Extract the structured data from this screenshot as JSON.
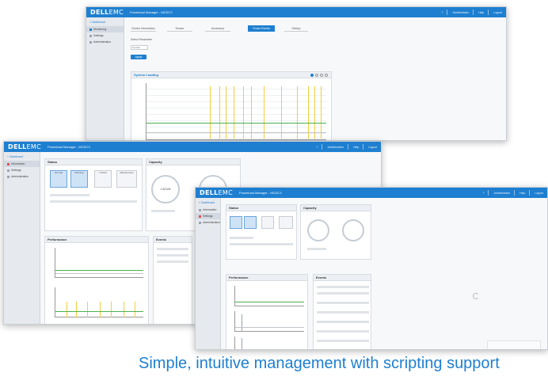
{
  "window_back": {
    "logo_main": "DELL",
    "logo_sub": "EMC",
    "title": "Powerload Manager - MCDC3",
    "titlebar_buttons": [
      "?",
      "Administrator",
      "Help",
      "Logout"
    ],
    "sidebar": {
      "back_link": "< Dashboard",
      "items": [
        {
          "label": "Monitoring"
        },
        {
          "label": "Settings"
        },
        {
          "label": "Administration"
        }
      ]
    },
    "tabs": [
      "Device Information",
      "Sensor",
      "Accessory",
      "Power Events",
      "History"
    ],
    "active_tab_index": 3,
    "filter_label": "Select Parameter",
    "filter_value": "Current",
    "apply_label": "Apply",
    "chart_panel_title": "System Loading"
  },
  "window_middle": {
    "logo_main": "DELL",
    "logo_sub": "EMC",
    "title": "Powerload Manager - MCDC3",
    "titlebar_buttons": [
      "?",
      "Administrator",
      "Help",
      "Logout"
    ],
    "sidebar": {
      "back_link": "< Dashboard",
      "items": [
        {
          "label": "Information"
        },
        {
          "label": "Settings"
        },
        {
          "label": "Administration"
        }
      ]
    },
    "status_panel_title": "Status",
    "status_chips": [
      "Normal",
      "Warning",
      "Critical",
      "Maintenance"
    ],
    "capacity_panel_title": "Capacity",
    "capacity_value": "1.52 kW",
    "performance_panel_title": "Performance",
    "events_panel_title": "Events"
  },
  "window_front": {
    "logo_main": "DELL",
    "logo_sub": "EMC",
    "title": "Powerload Manager - MCDC3",
    "titlebar_buttons": [
      "?",
      "Administrator",
      "Help",
      "Logout"
    ],
    "sidebar": {
      "back_link": "< Dashboard",
      "items": [
        {
          "label": "Information"
        },
        {
          "label": "Settings"
        },
        {
          "label": "Administration"
        }
      ]
    },
    "status_panel_title": "Status",
    "capacity_panel_title": "Capacity",
    "performance_panel_title": "Performance",
    "events_panel_title": "Events"
  },
  "caption": "Simple, intuitive management with scripting support",
  "colors": {
    "brand": "#1e7fd0",
    "chart_yellow": "#f2cf3a",
    "chart_green": "#4caf50"
  }
}
